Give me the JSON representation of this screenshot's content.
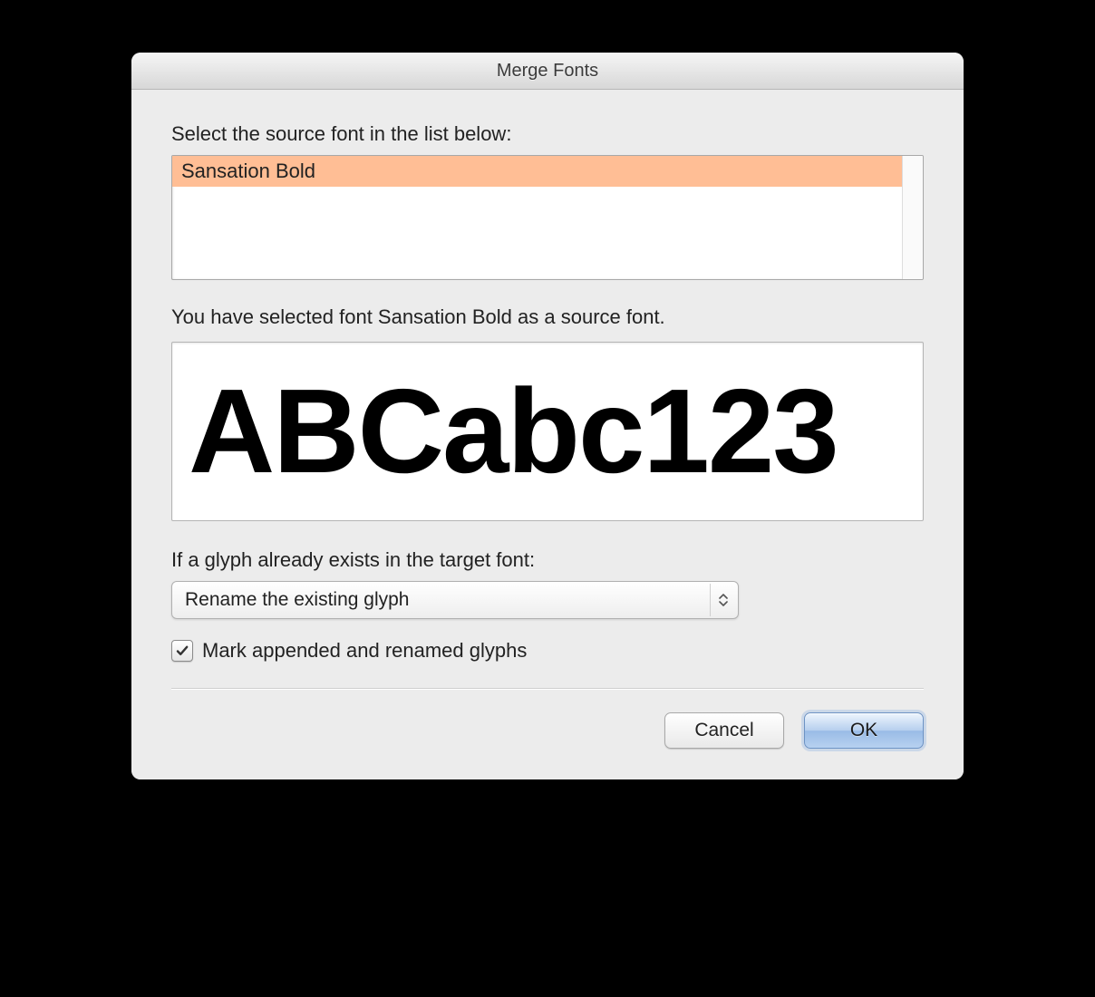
{
  "window": {
    "title": "Merge Fonts"
  },
  "labels": {
    "select_source": "Select the source font in the list below:",
    "selected_status": "You have selected font Sansation Bold as a source font.",
    "glyph_exists": "If a glyph already exists in the target font:"
  },
  "font_list": {
    "items": [
      "Sansation Bold"
    ],
    "selected_index": 0
  },
  "preview": {
    "sample_text": "ABCabc123"
  },
  "dropdown": {
    "selected": "Rename the existing glyph"
  },
  "checkbox": {
    "label": "Mark appended and renamed glyphs",
    "checked": true
  },
  "buttons": {
    "cancel": "Cancel",
    "ok": "OK"
  },
  "colors": {
    "selection_highlight": "#ffbe95",
    "window_bg": "#ececec"
  }
}
